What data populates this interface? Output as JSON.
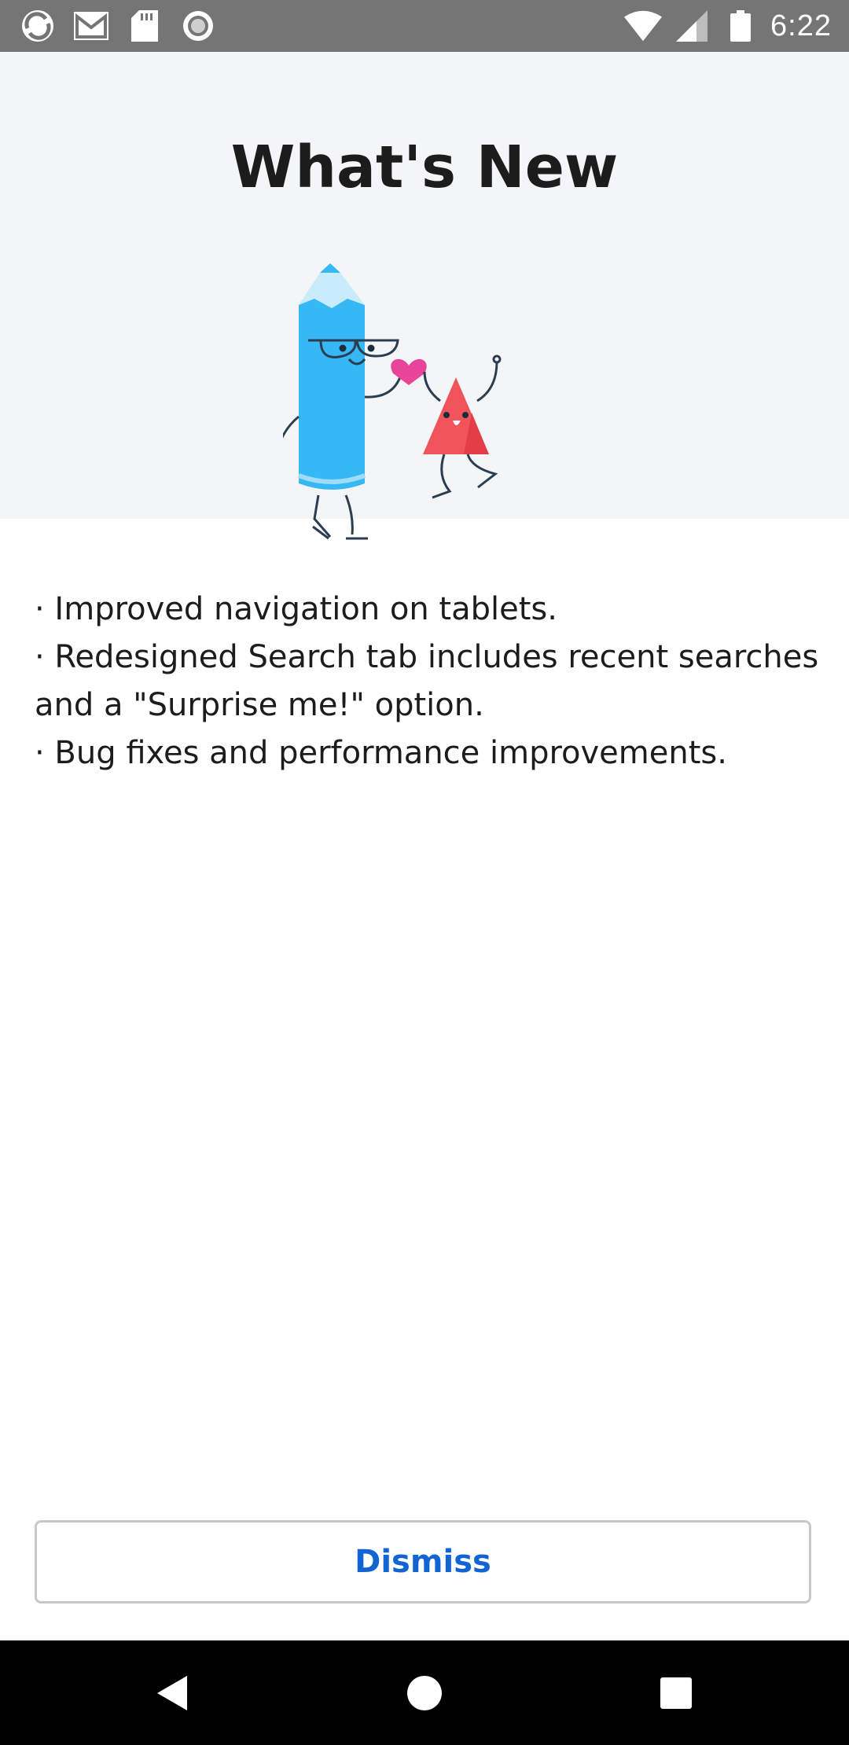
{
  "status_bar": {
    "time": "6:22",
    "left_icons": [
      "sync-icon",
      "gmail-icon",
      "sd-card-icon",
      "record-icon"
    ],
    "right_icons": [
      "wifi-icon",
      "cell-signal-icon",
      "battery-icon"
    ]
  },
  "dialog": {
    "title": "What's New",
    "notes": [
      "· Improved navigation on tablets.",
      "· Redesigned Search tab includes recent searches and a \"Surprise me!\" option.",
      "· Bug fixes and performance improvements."
    ],
    "dismiss_label": "Dismiss"
  },
  "colors": {
    "hero_bg": "#f4f5f7",
    "accent": "#1264d2",
    "pencil": "#36b8f4",
    "triangle": "#f2545b",
    "heart": "#e8459a"
  },
  "nav_bar": {
    "buttons": [
      "back-icon",
      "home-icon",
      "recents-icon"
    ]
  }
}
